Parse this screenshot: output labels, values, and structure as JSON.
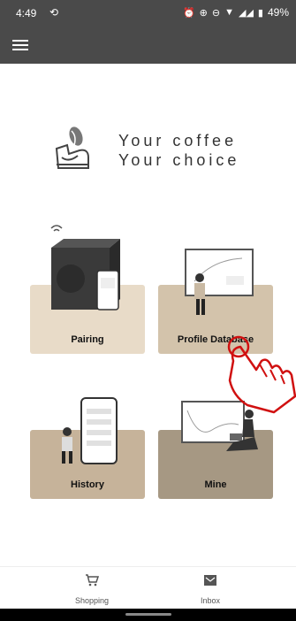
{
  "status_bar": {
    "time": "4:49",
    "battery": "49%",
    "icons": [
      "alarm-icon",
      "sync-icon",
      "minus-circle-icon",
      "wifi-icon",
      "signal-icon",
      "battery-icon"
    ]
  },
  "app_bar": {
    "menu_icon": "hamburger-menu-icon"
  },
  "logo": {
    "line1": "Your coffee",
    "line2": "Your choice"
  },
  "cards": {
    "pairing": {
      "label": "Pairing"
    },
    "profile_database": {
      "label": "Profile Database"
    },
    "history": {
      "label": "History"
    },
    "mine": {
      "label": "Mine"
    }
  },
  "bottom_nav": {
    "shopping": {
      "label": "Shopping",
      "icon": "cart-icon"
    },
    "inbox": {
      "label": "Inbox",
      "icon": "inbox-icon"
    }
  },
  "colors": {
    "appbar": "#4a4a4a",
    "card_pairing": "#e8dbc8",
    "card_profile": "#d3c3ab",
    "card_history": "#c6b39a",
    "card_mine": "#a69883",
    "hand_cursor": "#d01010"
  }
}
